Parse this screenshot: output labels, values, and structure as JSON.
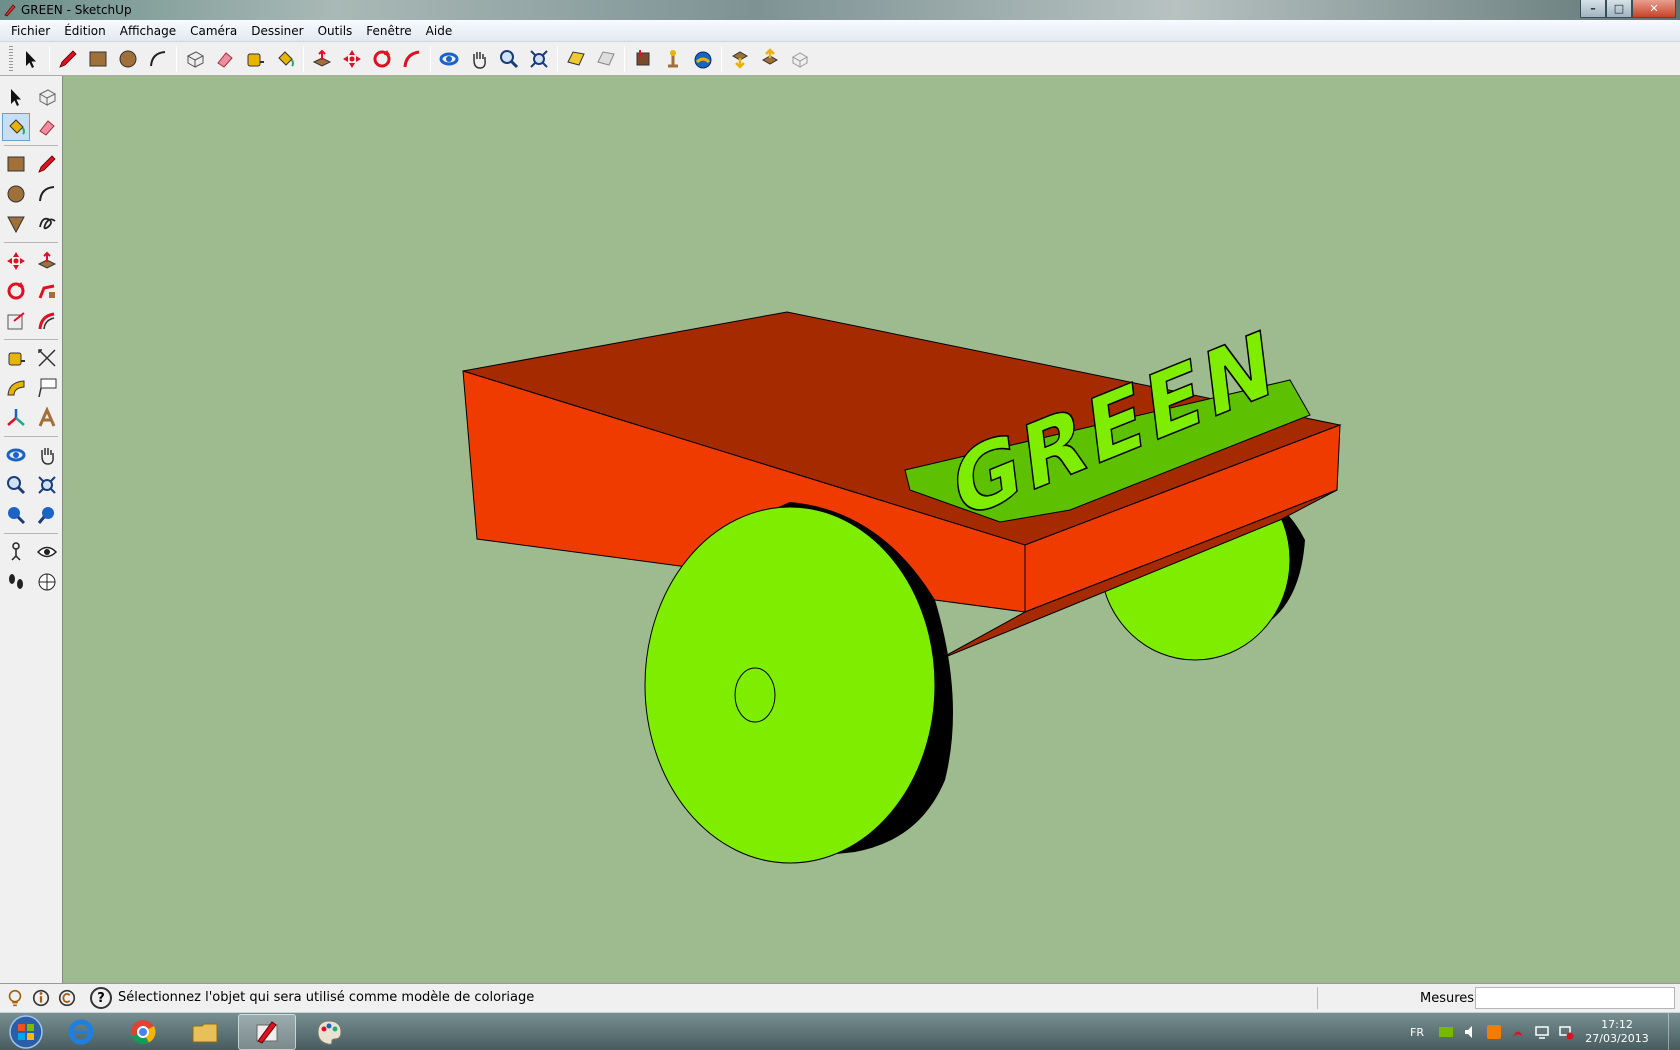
{
  "window": {
    "title": "GREEN - SketchUp",
    "controls": {
      "minimize": "–",
      "maximize": "□",
      "close": "✕"
    }
  },
  "menu": [
    "Fichier",
    "Édition",
    "Affichage",
    "Caméra",
    "Dessiner",
    "Outils",
    "Fenêtre",
    "Aide"
  ],
  "toolbar_icons": [
    "select-icon",
    "pencil-icon",
    "rectangle-icon",
    "circle-icon",
    "arc-icon",
    "make-component-icon",
    "eraser-icon",
    "tape-measure-icon",
    "paint-bucket-icon",
    "push-pull-icon",
    "move-icon",
    "rotate-icon",
    "follow-me-icon",
    "orbit-icon",
    "pan-icon",
    "zoom-icon",
    "zoom-extents-icon",
    "section-plane-icon",
    "section-display-icon",
    "add-location-icon",
    "photo-textures-icon",
    "google-earth-icon",
    "get-models-icon",
    "share-model-icon",
    "share-component-icon"
  ],
  "viewport": {
    "model_text": "GREEN",
    "colors": {
      "background": "#9dbb8e",
      "body_top": "#a52a00",
      "body_side": "#ef3b00",
      "wheel": "#7eed00",
      "tire": "#000000"
    }
  },
  "statusbar": {
    "message": "Sélectionnez l'objet qui sera utilisé comme modèle de coloriage",
    "help": "?",
    "measure_label": "Mesures",
    "measure_value": ""
  },
  "taskbar": {
    "language": "FR",
    "time": "17:12",
    "date": "27/03/2013"
  }
}
